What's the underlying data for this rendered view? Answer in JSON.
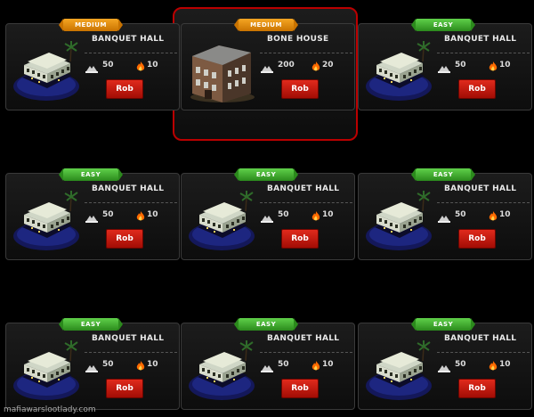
{
  "cards": [
    {
      "difficulty": "MEDIUM",
      "name": "BANQUET HALL",
      "stamina": "50",
      "energy": "10",
      "rob": "Rob",
      "image": "banquet-hall"
    },
    {
      "difficulty": "MEDIUM",
      "name": "BONE HOUSE",
      "stamina": "200",
      "energy": "20",
      "rob": "Rob",
      "image": "bone-house",
      "selected": true
    },
    {
      "difficulty": "EASY",
      "name": "BANQUET HALL",
      "stamina": "50",
      "energy": "10",
      "rob": "Rob",
      "image": "banquet-hall"
    },
    {
      "difficulty": "EASY",
      "name": "BANQUET HALL",
      "stamina": "50",
      "energy": "10",
      "rob": "Rob",
      "image": "banquet-hall"
    },
    {
      "difficulty": "EASY",
      "name": "BANQUET HALL",
      "stamina": "50",
      "energy": "10",
      "rob": "Rob",
      "image": "banquet-hall"
    },
    {
      "difficulty": "EASY",
      "name": "BANQUET HALL",
      "stamina": "50",
      "energy": "10",
      "rob": "Rob",
      "image": "banquet-hall"
    },
    {
      "difficulty": "EASY",
      "name": "BANQUET HALL",
      "stamina": "50",
      "energy": "10",
      "rob": "Rob",
      "image": "banquet-hall"
    },
    {
      "difficulty": "EASY",
      "name": "BANQUET HALL",
      "stamina": "50",
      "energy": "10",
      "rob": "Rob",
      "image": "banquet-hall"
    },
    {
      "difficulty": "EASY",
      "name": "BANQUET HALL",
      "stamina": "50",
      "energy": "10",
      "rob": "Rob",
      "image": "banquet-hall"
    }
  ],
  "watermark": "mafiawarslootlady.com",
  "colors": {
    "medium": "#f5a623",
    "easy": "#4bbf3a",
    "rob": "#d0190d",
    "selection": "#b00000"
  }
}
